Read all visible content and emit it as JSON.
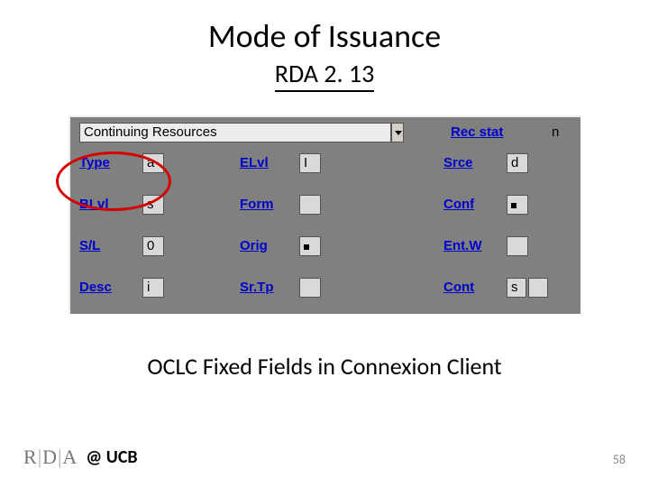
{
  "title": "Mode of Issuance",
  "subtitle": "RDA 2. 13",
  "caption": "OCLC Fixed Fields in Connexion Client",
  "footer": {
    "logo_letters": [
      "R",
      "D",
      "A"
    ],
    "at": "@ UCB"
  },
  "page_number": "58",
  "panel": {
    "top_field": "Continuing Resources",
    "rec_stat_label": "Rec stat",
    "rec_stat_value": "n",
    "rows": [
      {
        "c1_label": "Type",
        "c1_value": "a",
        "c2_label": "ELvl",
        "c2_value": "I",
        "c3_label": "Srce",
        "c3_value": "d"
      },
      {
        "c1_label": "BLvl",
        "c1_value": "s",
        "c2_label": "Form",
        "c2_value": "",
        "c3_label": "Conf",
        "c3_value": "•"
      },
      {
        "c1_label": "S/L",
        "c1_value": "0",
        "c2_label": "Orig",
        "c2_value": "•",
        "c3_label": "Ent.W",
        "c3_value": ""
      },
      {
        "c1_label": "Desc",
        "c1_value": "i",
        "c2_label": "Sr.Tp",
        "c2_value": "",
        "c3_label": "Cont",
        "c3_value": "s",
        "c3_extra": ""
      }
    ]
  }
}
